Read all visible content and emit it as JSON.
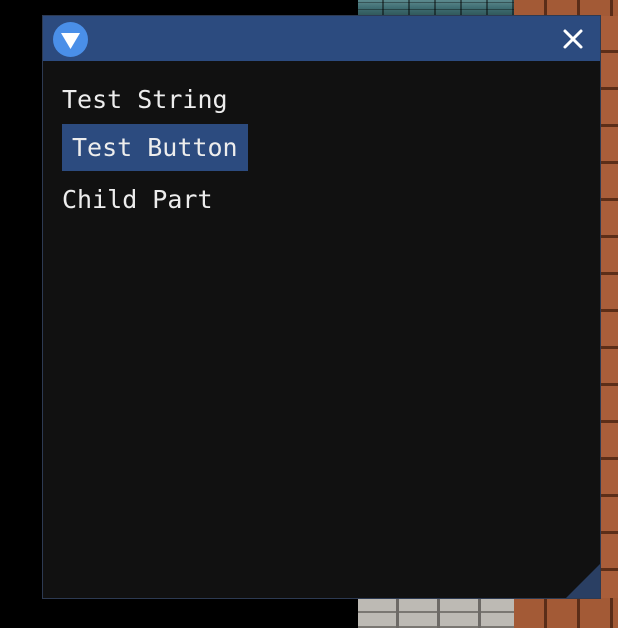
{
  "window": {
    "title_icons": {
      "collapse": "collapse-triangle-icon",
      "close": "close-x-icon"
    },
    "content": {
      "text_string": "Test String",
      "button_label": "Test Button",
      "child_text": "Child Part"
    }
  },
  "colors": {
    "titlebar": "#2c4b7f",
    "window_bg": "#111111",
    "button_bg": "#2c4b7f",
    "collapse_icon_bg": "#4a8fe8",
    "text": "#ededed"
  }
}
